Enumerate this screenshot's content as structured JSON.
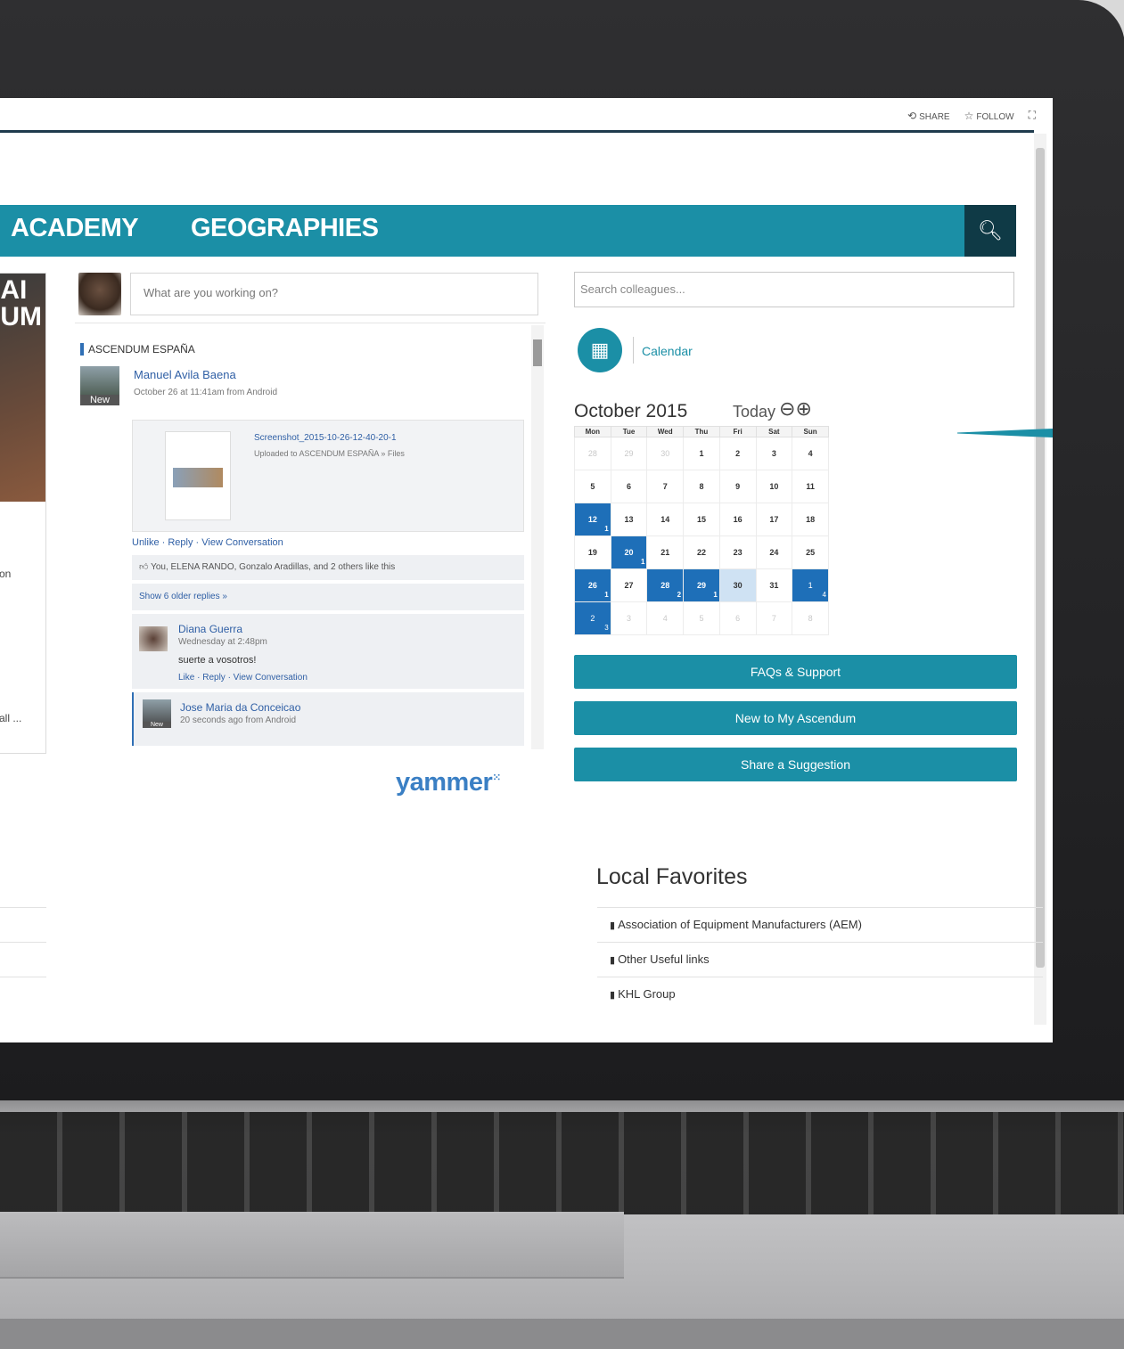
{
  "toolbar": {
    "share_label": "SHARE",
    "follow_label": "FOLLOW"
  },
  "nav": {
    "items": [
      "ACADEMY",
      "GEOGRAPHIES"
    ],
    "search_icon": "search-icon"
  },
  "left_card": {
    "image_text": "AI\nUM",
    "fragments": [
      "on",
      "all ..."
    ]
  },
  "composer": {
    "placeholder": "What are you working on?"
  },
  "feed": {
    "group": "ASCENDUM ESPAÑA",
    "post": {
      "author": "Manuel Avila Baena",
      "meta": "October 26 at 11:41am from Android",
      "badge": "New",
      "attachment_name": "Screenshot_2015-10-26-12-40-20-1",
      "attachment_sub": "Uploaded to ASCENDUM ESPAÑA » Files",
      "actions": "Unlike · Reply · View Conversation",
      "likes": "You, ELENA RANDO, Gonzalo Aradillas, and 2 others like this",
      "older": "Show 6 older replies »"
    },
    "reply": {
      "author": "Diana Guerra",
      "meta": "Wednesday at 2:48pm",
      "text": "suerte a vosotros!",
      "links": "Like · Reply · View Conversation"
    },
    "reply2": {
      "author": "Jose Maria da Conceicao",
      "meta": "20 seconds ago from Android",
      "badge": "New"
    },
    "brand": "yammer"
  },
  "sidebar": {
    "search_placeholder": "Search colleagues...",
    "calendar_link": "Calendar",
    "month_title": "October 2015",
    "today_label": "Today",
    "weekdays": [
      "Mon",
      "Tue",
      "Wed",
      "Thu",
      "Fri",
      "Sat",
      "Sun"
    ],
    "weeks": [
      [
        {
          "d": "28",
          "o": true
        },
        {
          "d": "29",
          "o": true
        },
        {
          "d": "30",
          "o": true
        },
        {
          "d": "1"
        },
        {
          "d": "2"
        },
        {
          "d": "3"
        },
        {
          "d": "4"
        }
      ],
      [
        {
          "d": "5"
        },
        {
          "d": "6"
        },
        {
          "d": "7"
        },
        {
          "d": "8"
        },
        {
          "d": "9"
        },
        {
          "d": "10"
        },
        {
          "d": "11"
        }
      ],
      [
        {
          "d": "12",
          "e": true,
          "c": "1"
        },
        {
          "d": "13"
        },
        {
          "d": "14"
        },
        {
          "d": "15"
        },
        {
          "d": "16"
        },
        {
          "d": "17"
        },
        {
          "d": "18"
        }
      ],
      [
        {
          "d": "19"
        },
        {
          "d": "20",
          "e": true,
          "c": "1"
        },
        {
          "d": "21"
        },
        {
          "d": "22"
        },
        {
          "d": "23"
        },
        {
          "d": "24"
        },
        {
          "d": "25"
        }
      ],
      [
        {
          "d": "26",
          "e": true,
          "c": "1"
        },
        {
          "d": "27"
        },
        {
          "d": "28",
          "e": true,
          "c": "2"
        },
        {
          "d": "29",
          "e": true,
          "c": "1"
        },
        {
          "d": "30",
          "t": true
        },
        {
          "d": "31"
        },
        {
          "d": "1",
          "o": true,
          "e": true,
          "c": "4"
        }
      ],
      [
        {
          "d": "2",
          "o": true,
          "e": true,
          "c": "3"
        },
        {
          "d": "3",
          "o": true
        },
        {
          "d": "4",
          "o": true
        },
        {
          "d": "5",
          "o": true
        },
        {
          "d": "6",
          "o": true
        },
        {
          "d": "7",
          "o": true
        },
        {
          "d": "8",
          "o": true
        }
      ]
    ],
    "buttons": [
      "FAQs & Support",
      "New to My Ascendum",
      "Share a Suggestion"
    ]
  },
  "favorites": {
    "title": "Local Favorites",
    "items": [
      "Association of Equipment Manufacturers (AEM)",
      "Other Useful links",
      "KHL Group"
    ]
  },
  "colors": {
    "accent": "#1b8fa6",
    "nav_dark": "#0f3a46",
    "event": "#1e6fb8",
    "link": "#2f5fa5"
  }
}
